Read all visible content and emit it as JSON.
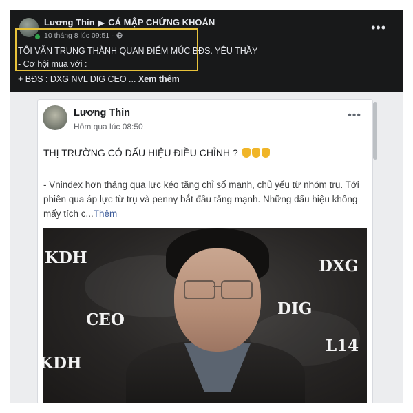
{
  "top_post": {
    "author": "Lương Thin",
    "separator": "▶",
    "group": "CÁ MẬP CHỨNG KHOÁN",
    "timestamp": "10 tháng 8 lúc 09:51 ·",
    "audience_icon": "globe-icon",
    "more_label": "•••",
    "line1": "TÔI VẪN TRUNG THÀNH QUAN ĐIỂM MÚC BĐS. YÊU THẦY",
    "line2": "- Cơ hội mua với :",
    "line3": "+ BĐS : DXG NVL DIG CEO ...",
    "see_more": "Xem thêm",
    "highlight_color": "#e8c23a"
  },
  "shared_post": {
    "author": "Lương Thin",
    "timestamp": "Hôm qua lúc 08:50",
    "more_label": "•••",
    "headline": "THỊ TRƯỜNG CÓ DẤU HIỆU ĐIỀU CHỈNH ?",
    "headline_icon": "pointing-down-hand-emoji",
    "body": "- Vnindex hơn tháng qua lực kéo tăng chỉ số mạnh, chủ yếu từ nhóm trụ. Tới phiên qua áp lực từ trụ và penny bắt đầu tăng mạnh. Những dấu hiệu không mấy tích c...",
    "more_link": "Thêm",
    "image_labels": {
      "kdh_top": "KDH",
      "dxg": "DXG",
      "ceo": "CEO",
      "dig": "DIG",
      "l14": "L14",
      "kdh_bottom": "KDH"
    }
  }
}
